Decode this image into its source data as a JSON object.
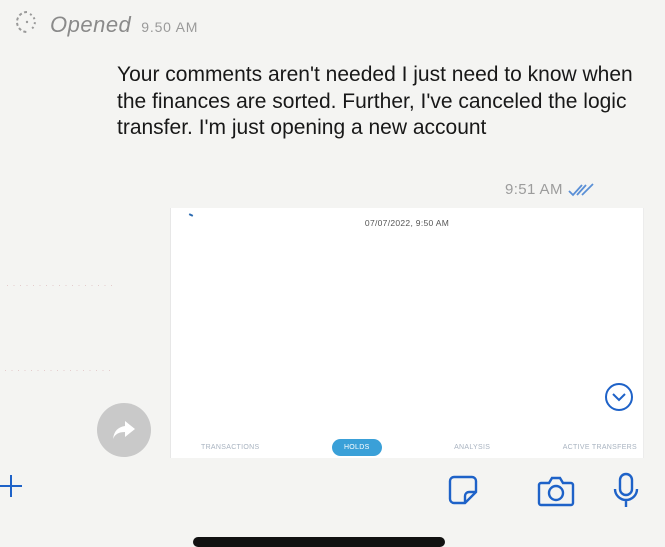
{
  "status": {
    "label": "Opened",
    "time": "9.50 AM"
  },
  "message": {
    "text": "Your comments aren't needed I just need to know when the finances are sorted. Further, I've canceled the logic transfer. I'm just opening a new account",
    "time": "9:51 AM",
    "read_state_icon": "double-check-icon"
  },
  "attachment": {
    "timestamp": "07/07/2022, 9:50 AM",
    "tabs": [
      {
        "label": "TRANSACTIONS",
        "active": false
      },
      {
        "label": "HOLDS",
        "active": true
      },
      {
        "label": "ANALYSIS",
        "active": false
      },
      {
        "label": "ACTIVE TRANSFERS",
        "active": false
      }
    ]
  },
  "colors": {
    "accent": "#3aa0d8",
    "icon_blue": "#1e62c8",
    "muted_text": "#9a9a9a"
  },
  "icons": {
    "status": "opened-spinner-icon",
    "expand": "chevron-down-circle-icon",
    "forward": "forward-arrow-icon",
    "plus": "plus-icon",
    "sticker": "sticker-icon",
    "camera": "camera-icon",
    "mic": "microphone-icon"
  }
}
